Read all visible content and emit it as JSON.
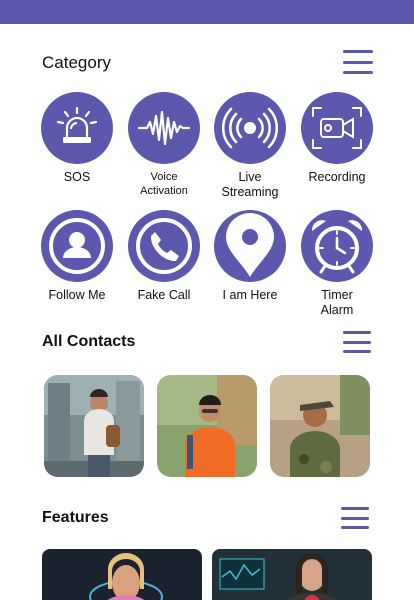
{
  "header": {
    "color": "#5b58ad"
  },
  "category": {
    "title": "Category",
    "items": [
      {
        "label": "SOS",
        "icon": "siren-icon"
      },
      {
        "label": "Voice\nActivation",
        "icon": "voice-wave-icon"
      },
      {
        "label": "Live\nStreaming",
        "icon": "broadcast-icon"
      },
      {
        "label": "Recording",
        "icon": "video-camera-icon"
      },
      {
        "label": "Follow Me",
        "icon": "user-icon"
      },
      {
        "label": "Fake Call",
        "icon": "phone-icon"
      },
      {
        "label": "I am Here",
        "icon": "location-pin-icon"
      },
      {
        "label": "Timer\nAlarm",
        "icon": "alarm-clock-icon"
      }
    ]
  },
  "contacts": {
    "title": "All Contacts",
    "photos": [
      "contact-photo-1",
      "contact-photo-2",
      "contact-photo-3"
    ]
  },
  "features": {
    "title": "Features",
    "cards": [
      "feature-card-1",
      "feature-card-2"
    ]
  },
  "colors": {
    "accent": "#5b58ad",
    "text": "#111111",
    "background": "#ffffff"
  }
}
